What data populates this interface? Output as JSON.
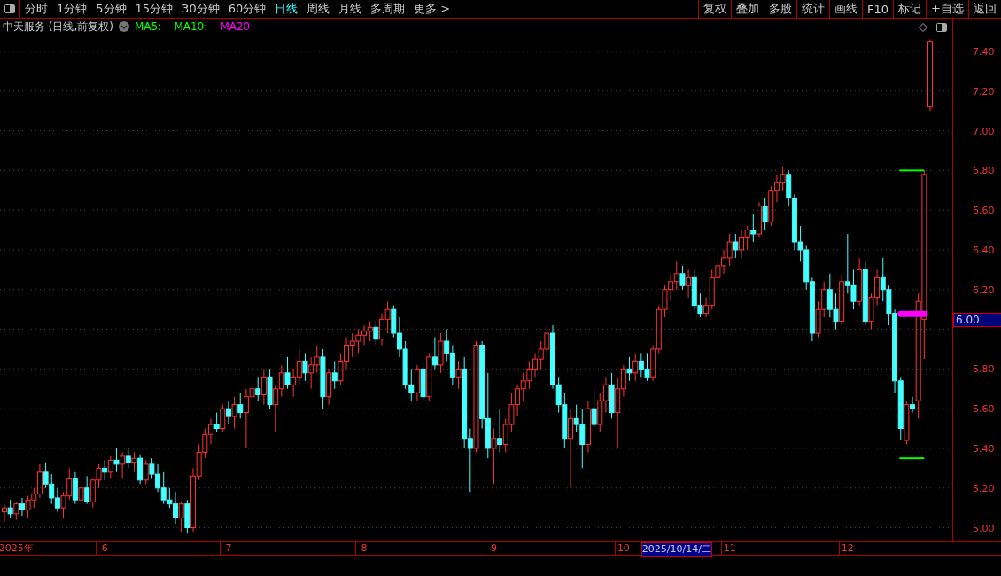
{
  "period_tabs": [
    {
      "label": "分时",
      "selected": false
    },
    {
      "label": "1分钟",
      "selected": false
    },
    {
      "label": "5分钟",
      "selected": false
    },
    {
      "label": "15分钟",
      "selected": false
    },
    {
      "label": "30分钟",
      "selected": false
    },
    {
      "label": "60分钟",
      "selected": false
    },
    {
      "label": "日线",
      "selected": true
    },
    {
      "label": "周线",
      "selected": false
    },
    {
      "label": "月线",
      "selected": false
    },
    {
      "label": "多周期",
      "selected": false
    },
    {
      "label": "更多 >",
      "selected": false
    }
  ],
  "tool_buttons": [
    "复权",
    "叠加",
    "多股",
    "统计",
    "画线",
    "F10",
    "标记",
    "+自选",
    "返回"
  ],
  "chart_title": "中天服务 (日线,前复权)",
  "indicators": [
    {
      "label": "MA5: -",
      "color": "#00ff00"
    },
    {
      "label": "MA10: -",
      "color": "#00ff00"
    },
    {
      "label": "MA20: -",
      "color": "#ff00ff"
    }
  ],
  "chart_data": {
    "type": "candlestick",
    "grid": true,
    "ylim": [
      4.931,
      7.565
    ],
    "yticks": [
      {
        "value": 7.4,
        "label": "7.40"
      },
      {
        "value": 7.2,
        "label": "7.20"
      },
      {
        "value": 7.0,
        "label": "7.00"
      },
      {
        "value": 6.8,
        "label": "6.80"
      },
      {
        "value": 6.6,
        "label": "6.60"
      },
      {
        "value": 6.4,
        "label": "6.40"
      },
      {
        "value": 6.2,
        "label": "6.20"
      },
      {
        "value": 5.8,
        "label": "5.80"
      },
      {
        "value": 5.6,
        "label": "5.60"
      },
      {
        "value": 5.4,
        "label": "5.40"
      },
      {
        "value": 5.2,
        "label": "5.20"
      },
      {
        "value": 5.0,
        "label": "5.00"
      }
    ],
    "categories": [
      null,
      null,
      "2025年",
      null,
      null,
      null,
      null,
      null,
      null,
      null,
      null,
      null,
      null,
      null,
      null,
      null,
      null,
      "6",
      null,
      null,
      null,
      null,
      null,
      null,
      null,
      null,
      null,
      null,
      null,
      null,
      null,
      null,
      null,
      null,
      null,
      null,
      null,
      null,
      "7",
      null,
      null,
      null,
      null,
      null,
      null,
      null,
      null,
      null,
      null,
      null,
      null,
      null,
      null,
      null,
      null,
      null,
      null,
      null,
      null,
      null,
      null,
      "8",
      null,
      null,
      null,
      null,
      null,
      null,
      null,
      null,
      null,
      null,
      null,
      null,
      null,
      null,
      null,
      null,
      null,
      null,
      null,
      null,
      null,
      "9",
      null,
      null,
      null,
      null,
      null,
      null,
      null,
      null,
      null,
      null,
      null,
      null,
      null,
      null,
      null,
      null,
      null,
      null,
      null,
      null,
      null,
      "10",
      null,
      null,
      null,
      null,
      null,
      null,
      null,
      null,
      null,
      null,
      null,
      null,
      null,
      null,
      null,
      null,
      null,
      "11",
      null,
      null,
      null,
      null,
      null,
      null,
      null,
      null,
      null,
      null,
      null,
      null,
      null,
      null,
      null,
      null,
      null,
      null,
      null,
      "12",
      null,
      null,
      null,
      null,
      null,
      null,
      null,
      null,
      null,
      null,
      null,
      null,
      null,
      null
    ],
    "ohlc": [
      [
        5.08,
        5.12,
        5.03,
        5.1
      ],
      [
        5.1,
        5.14,
        5.05,
        5.07
      ],
      [
        5.07,
        5.13,
        5.04,
        5.12
      ],
      [
        5.12,
        5.15,
        5.06,
        5.09
      ],
      [
        5.09,
        5.16,
        5.05,
        5.14
      ],
      [
        5.14,
        5.2,
        5.1,
        5.17
      ],
      [
        5.17,
        5.32,
        5.15,
        5.28
      ],
      [
        5.28,
        5.33,
        5.2,
        5.22
      ],
      [
        5.22,
        5.27,
        5.12,
        5.15
      ],
      [
        5.15,
        5.2,
        5.08,
        5.1
      ],
      [
        5.1,
        5.18,
        5.05,
        5.16
      ],
      [
        5.16,
        5.3,
        5.14,
        5.25
      ],
      [
        5.25,
        5.28,
        5.12,
        5.14
      ],
      [
        5.14,
        5.22,
        5.1,
        5.2
      ],
      [
        5.2,
        5.26,
        5.12,
        5.13
      ],
      [
        5.13,
        5.25,
        5.1,
        5.24
      ],
      [
        5.24,
        5.32,
        5.2,
        5.3
      ],
      [
        5.3,
        5.34,
        5.24,
        5.28
      ],
      [
        5.28,
        5.36,
        5.25,
        5.34
      ],
      [
        5.34,
        5.4,
        5.28,
        5.32
      ],
      [
        5.32,
        5.38,
        5.25,
        5.36
      ],
      [
        5.36,
        5.4,
        5.3,
        5.33
      ],
      [
        5.33,
        5.38,
        5.28,
        5.35
      ],
      [
        5.35,
        5.37,
        5.22,
        5.24
      ],
      [
        5.24,
        5.34,
        5.22,
        5.32
      ],
      [
        5.32,
        5.35,
        5.25,
        5.27
      ],
      [
        5.27,
        5.32,
        5.18,
        5.2
      ],
      [
        5.2,
        5.28,
        5.12,
        5.14
      ],
      [
        5.14,
        5.2,
        5.1,
        5.12
      ],
      [
        5.12,
        5.18,
        5.02,
        5.05
      ],
      [
        5.05,
        5.13,
        4.98,
        5.12
      ],
      [
        5.12,
        5.14,
        4.97,
        5.0
      ],
      [
        5.0,
        5.3,
        4.98,
        5.26
      ],
      [
        5.26,
        5.42,
        5.24,
        5.38
      ],
      [
        5.38,
        5.5,
        5.35,
        5.47
      ],
      [
        5.47,
        5.55,
        5.42,
        5.52
      ],
      [
        5.52,
        5.58,
        5.48,
        5.5
      ],
      [
        5.5,
        5.62,
        5.48,
        5.6
      ],
      [
        5.6,
        5.64,
        5.52,
        5.56
      ],
      [
        5.56,
        5.66,
        5.5,
        5.62
      ],
      [
        5.62,
        5.68,
        5.55,
        5.58
      ],
      [
        5.58,
        5.7,
        5.4,
        5.66
      ],
      [
        5.66,
        5.74,
        5.6,
        5.7
      ],
      [
        5.7,
        5.76,
        5.64,
        5.67
      ],
      [
        5.67,
        5.8,
        5.62,
        5.76
      ],
      [
        5.76,
        5.8,
        5.6,
        5.62
      ],
      [
        5.62,
        5.72,
        5.48,
        5.7
      ],
      [
        5.7,
        5.82,
        5.66,
        5.78
      ],
      [
        5.78,
        5.86,
        5.7,
        5.72
      ],
      [
        5.72,
        5.8,
        5.66,
        5.76
      ],
      [
        5.76,
        5.9,
        5.72,
        5.84
      ],
      [
        5.84,
        5.88,
        5.74,
        5.78
      ],
      [
        5.78,
        5.86,
        5.7,
        5.82
      ],
      [
        5.82,
        5.92,
        5.78,
        5.86
      ],
      [
        5.86,
        5.9,
        5.6,
        5.66
      ],
      [
        5.66,
        5.8,
        5.62,
        5.78
      ],
      [
        5.78,
        5.84,
        5.7,
        5.74
      ],
      [
        5.74,
        5.88,
        5.72,
        5.84
      ],
      [
        5.84,
        5.96,
        5.8,
        5.92
      ],
      [
        5.92,
        5.98,
        5.86,
        5.94
      ],
      [
        5.94,
        6.0,
        5.88,
        5.97
      ],
      [
        5.97,
        6.02,
        5.92,
        5.99
      ],
      [
        5.99,
        6.04,
        5.94,
        6.01
      ],
      [
        6.01,
        6.04,
        5.92,
        5.95
      ],
      [
        5.95,
        6.08,
        5.92,
        6.05
      ],
      [
        6.05,
        6.14,
        5.98,
        6.1
      ],
      [
        6.1,
        6.12,
        5.96,
        5.98
      ],
      [
        5.98,
        6.06,
        5.86,
        5.9
      ],
      [
        5.9,
        5.94,
        5.7,
        5.72
      ],
      [
        5.72,
        5.8,
        5.64,
        5.68
      ],
      [
        5.68,
        5.82,
        5.64,
        5.8
      ],
      [
        5.8,
        5.84,
        5.64,
        5.66
      ],
      [
        5.66,
        5.88,
        5.64,
        5.86
      ],
      [
        5.86,
        5.96,
        5.8,
        5.82
      ],
      [
        5.82,
        5.98,
        5.78,
        5.94
      ],
      [
        5.94,
        6.0,
        5.84,
        5.88
      ],
      [
        5.88,
        5.92,
        5.72,
        5.76
      ],
      [
        5.76,
        5.84,
        5.7,
        5.8
      ],
      [
        5.8,
        5.86,
        5.4,
        5.45
      ],
      [
        5.45,
        5.5,
        5.18,
        5.4
      ],
      [
        5.4,
        5.94,
        5.38,
        5.92
      ],
      [
        5.92,
        5.94,
        5.5,
        5.55
      ],
      [
        5.55,
        5.78,
        5.35,
        5.4
      ],
      [
        5.4,
        5.5,
        5.22,
        5.45
      ],
      [
        5.45,
        5.6,
        5.38,
        5.42
      ],
      [
        5.42,
        5.55,
        5.38,
        5.52
      ],
      [
        5.52,
        5.68,
        5.48,
        5.62
      ],
      [
        5.62,
        5.72,
        5.56,
        5.7
      ],
      [
        5.7,
        5.78,
        5.64,
        5.74
      ],
      [
        5.74,
        5.84,
        5.7,
        5.8
      ],
      [
        5.8,
        5.88,
        5.76,
        5.85
      ],
      [
        5.85,
        5.94,
        5.8,
        5.9
      ],
      [
        5.9,
        6.02,
        5.86,
        5.98
      ],
      [
        5.98,
        6.02,
        5.7,
        5.72
      ],
      [
        5.72,
        5.76,
        5.58,
        5.62
      ],
      [
        5.62,
        5.68,
        5.4,
        5.45
      ],
      [
        5.45,
        5.6,
        5.2,
        5.55
      ],
      [
        5.55,
        5.62,
        5.48,
        5.52
      ],
      [
        5.52,
        5.6,
        5.3,
        5.42
      ],
      [
        5.42,
        5.64,
        5.38,
        5.6
      ],
      [
        5.6,
        5.7,
        5.5,
        5.52
      ],
      [
        5.52,
        5.68,
        5.48,
        5.64
      ],
      [
        5.64,
        5.76,
        5.58,
        5.72
      ],
      [
        5.72,
        5.78,
        5.55,
        5.58
      ],
      [
        5.58,
        5.76,
        5.4,
        5.7
      ],
      [
        5.7,
        5.82,
        5.66,
        5.8
      ],
      [
        5.8,
        5.86,
        5.74,
        5.78
      ],
      [
        5.78,
        5.88,
        5.74,
        5.84
      ],
      [
        5.84,
        5.88,
        5.76,
        5.8
      ],
      [
        5.8,
        5.88,
        5.74,
        5.76
      ],
      [
        5.76,
        5.92,
        5.74,
        5.9
      ],
      [
        5.9,
        6.12,
        5.88,
        6.1
      ],
      [
        6.1,
        6.22,
        6.06,
        6.2
      ],
      [
        6.2,
        6.28,
        6.14,
        6.24
      ],
      [
        6.24,
        6.34,
        6.2,
        6.28
      ],
      [
        6.28,
        6.32,
        6.2,
        6.22
      ],
      [
        6.22,
        6.3,
        6.16,
        6.26
      ],
      [
        6.26,
        6.3,
        6.1,
        6.12
      ],
      [
        6.12,
        6.18,
        6.06,
        6.08
      ],
      [
        6.08,
        6.16,
        6.06,
        6.12
      ],
      [
        6.12,
        6.3,
        6.1,
        6.26
      ],
      [
        6.26,
        6.36,
        6.22,
        6.32
      ],
      [
        6.32,
        6.4,
        6.28,
        6.36
      ],
      [
        6.36,
        6.48,
        6.32,
        6.44
      ],
      [
        6.44,
        6.48,
        6.36,
        6.4
      ],
      [
        6.4,
        6.5,
        6.36,
        6.46
      ],
      [
        6.46,
        6.52,
        6.4,
        6.5
      ],
      [
        6.5,
        6.58,
        6.44,
        6.48
      ],
      [
        6.48,
        6.64,
        6.46,
        6.62
      ],
      [
        6.62,
        6.66,
        6.5,
        6.54
      ],
      [
        6.54,
        6.72,
        6.52,
        6.7
      ],
      [
        6.7,
        6.78,
        6.64,
        6.74
      ],
      [
        6.74,
        6.82,
        6.7,
        6.78
      ],
      [
        6.78,
        6.8,
        6.62,
        6.66
      ],
      [
        6.66,
        6.68,
        6.4,
        6.44
      ],
      [
        6.44,
        6.52,
        6.34,
        6.4
      ],
      [
        6.4,
        6.42,
        6.2,
        6.24
      ],
      [
        6.24,
        6.26,
        5.94,
        5.98
      ],
      [
        5.98,
        6.14,
        5.96,
        6.1
      ],
      [
        6.1,
        6.24,
        6.06,
        6.2
      ],
      [
        6.2,
        6.28,
        6.06,
        6.1
      ],
      [
        6.1,
        6.18,
        6.0,
        6.04
      ],
      [
        6.04,
        6.28,
        6.02,
        6.24
      ],
      [
        6.24,
        6.48,
        6.18,
        6.22
      ],
      [
        6.22,
        6.3,
        6.1,
        6.14
      ],
      [
        6.14,
        6.36,
        6.12,
        6.3
      ],
      [
        6.3,
        6.34,
        6.02,
        6.04
      ],
      [
        6.04,
        6.18,
        6.0,
        6.16
      ],
      [
        6.16,
        6.3,
        6.12,
        6.26
      ],
      [
        6.26,
        6.36,
        6.14,
        6.2
      ],
      [
        6.2,
        6.22,
        6.02,
        6.08
      ],
      [
        6.08,
        6.1,
        5.68,
        5.74
      ],
      [
        5.74,
        5.76,
        5.44,
        5.5
      ],
      [
        5.44,
        5.64,
        5.42,
        5.62
      ],
      [
        5.62,
        5.66,
        5.58,
        5.6
      ],
      [
        5.64,
        6.18,
        5.55,
        6.14
      ],
      [
        6.05,
        6.8,
        5.85,
        6.78
      ],
      [
        7.12,
        7.46,
        7.1,
        7.45
      ]
    ]
  },
  "cursor_price": "6.00",
  "cursor_date": "2025/10/14/二"
}
